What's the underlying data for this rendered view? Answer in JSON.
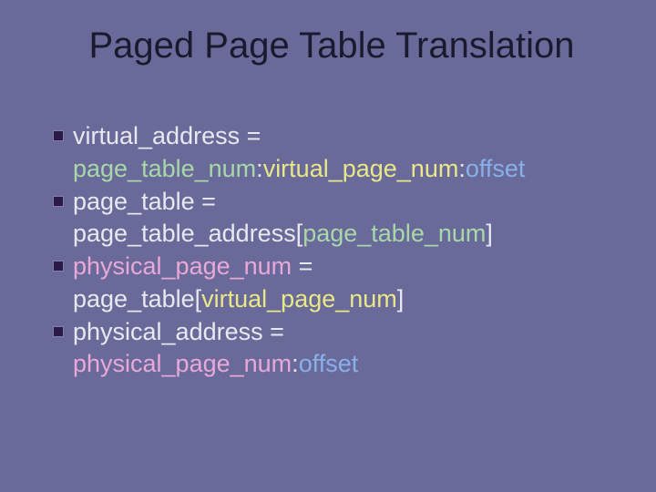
{
  "title": "Paged Page Table Translation",
  "items": [
    {
      "lead": "virtual_address = ",
      "cont_prefix": "",
      "g": "page_table_num",
      "sep1": ":",
      "y": "virtual_page_num",
      "sep2": ":",
      "b": "offset",
      "suffix": ""
    },
    {
      "lead": "page_table = ",
      "cont_prefix": "page_table_address[",
      "g": "page_table_num",
      "sep1": "",
      "y": "",
      "sep2": "",
      "b": "",
      "suffix": "]"
    },
    {
      "lead": "",
      "p": "physical_page_num",
      "lead2": " = ",
      "cont_prefix": "page_table[",
      "g": "",
      "sep1": "",
      "y": "virtual_page_num",
      "sep2": "",
      "b": "",
      "suffix": "]"
    },
    {
      "lead": "physical_address = ",
      "cont_prefix": "",
      "p": "physical_page_num",
      "sep1": ":",
      "g": "",
      "y": "",
      "sep2": "",
      "b": "offset",
      "suffix": ""
    }
  ]
}
